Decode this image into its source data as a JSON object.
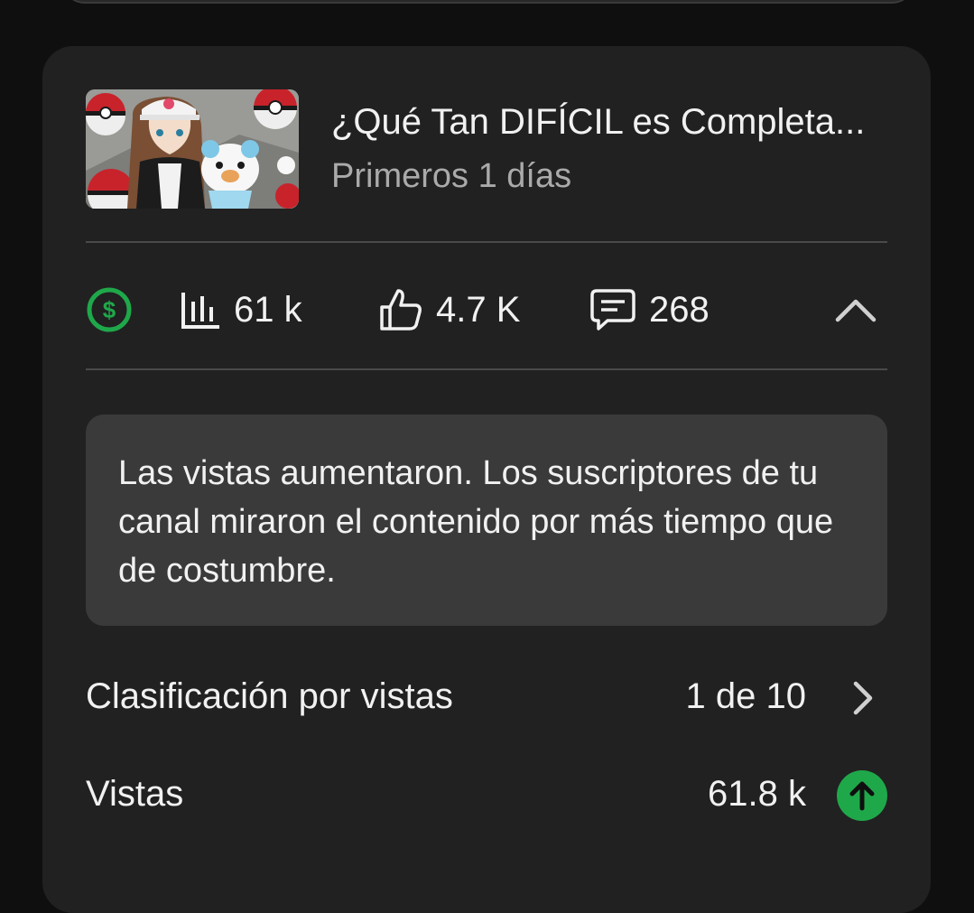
{
  "video": {
    "title": "¿Qué Tan DIFÍCIL es Completa...",
    "period": "Primeros 1 días"
  },
  "stats": {
    "monetization_icon": "dollar-circle-icon",
    "views_icon": "bar-chart-icon",
    "views": "61 k",
    "likes_icon": "thumbs-up-icon",
    "likes": "4.7 K",
    "comments_icon": "comment-icon",
    "comments": "268",
    "collapse_icon": "chevron-up-icon"
  },
  "insight": {
    "text": "Las vistas aumentaron. Los suscriptores de tu canal miraron el contenido por más tiempo que de costumbre."
  },
  "metrics": [
    {
      "label": "Clasificación por vistas",
      "value": "1 de 10",
      "icon": "chevron-right-icon"
    },
    {
      "label": "Vistas",
      "value": "61.8 k",
      "icon": "arrow-up-circle-icon"
    }
  ],
  "colors": {
    "background": "#0f0f0f",
    "card": "#212121",
    "insight_bg": "#3a3a3a",
    "accent_green": "#1fa84a",
    "text_primary": "#f1f1f1",
    "text_secondary": "#aaaaaa"
  }
}
